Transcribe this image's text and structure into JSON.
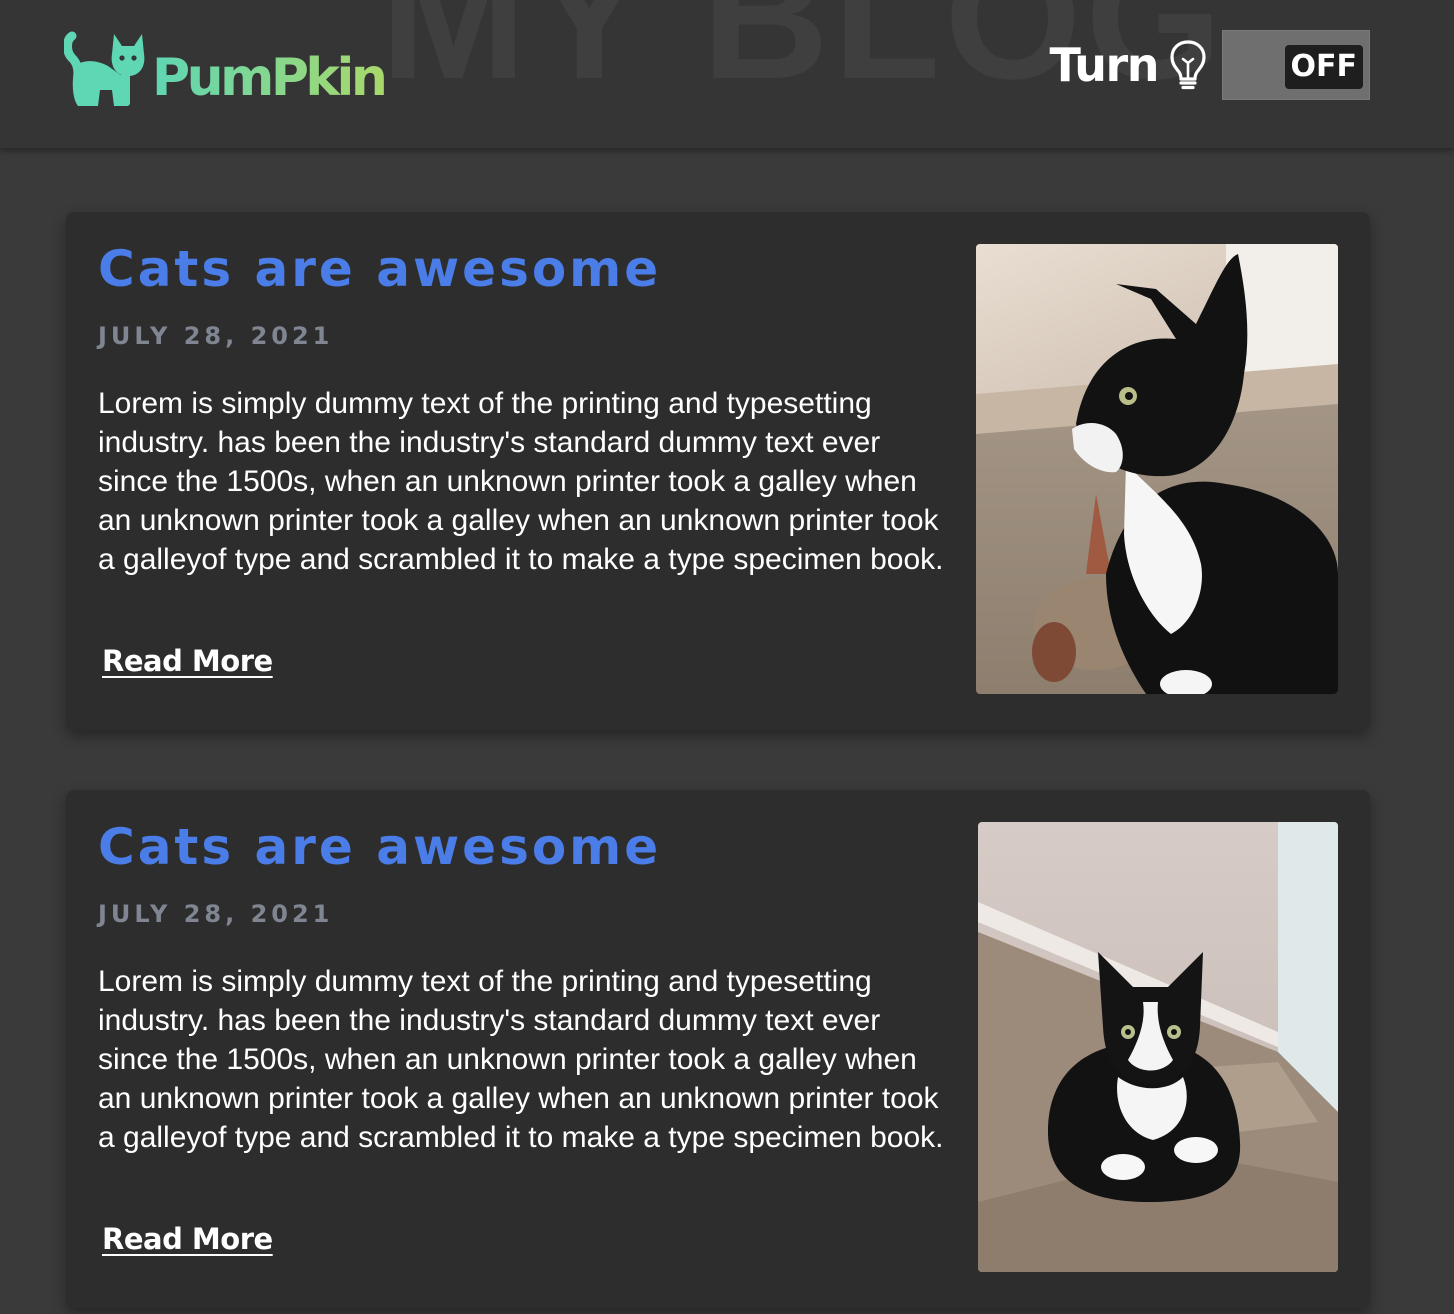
{
  "header": {
    "background_title": "MY BLOG",
    "logo_text": "PumPkin",
    "toggle_label": "Turn",
    "toggle_state": "OFF"
  },
  "posts": [
    {
      "title": "Cats are awesome",
      "date": "JULY 28, 2021",
      "body": "Lorem is simply dummy text of the printing and typesetting industry. has been the industry's standard dummy text ever since the 1500s, when an unknown printer took a galley when an unknown printer took a galley when an unknown printer took a galleyof type and scrambled it to make a type specimen book.",
      "link": "Read More"
    },
    {
      "title": "Cats are awesome",
      "date": "JULY 28, 2021",
      "body": "Lorem is simply dummy text of the printing and typesetting industry. has been the industry's standard dummy text ever since the 1500s, when an unknown printer took a galley when an unknown printer took a galley when an unknown printer took a galleyof type and scrambled it to make a type specimen book.",
      "link": "Read More"
    }
  ],
  "icons": {
    "logo": "cat-icon",
    "toggle": "lightbulb-icon"
  },
  "colors": {
    "page_background": "#3a3a3a",
    "header_background": "#353535",
    "card_background": "#2d2d2d",
    "title_blue": "#4a7de8",
    "date_gray": "#7f8591",
    "logo_green": "#5fd6b4",
    "logo_lime": "#a9d86b"
  }
}
